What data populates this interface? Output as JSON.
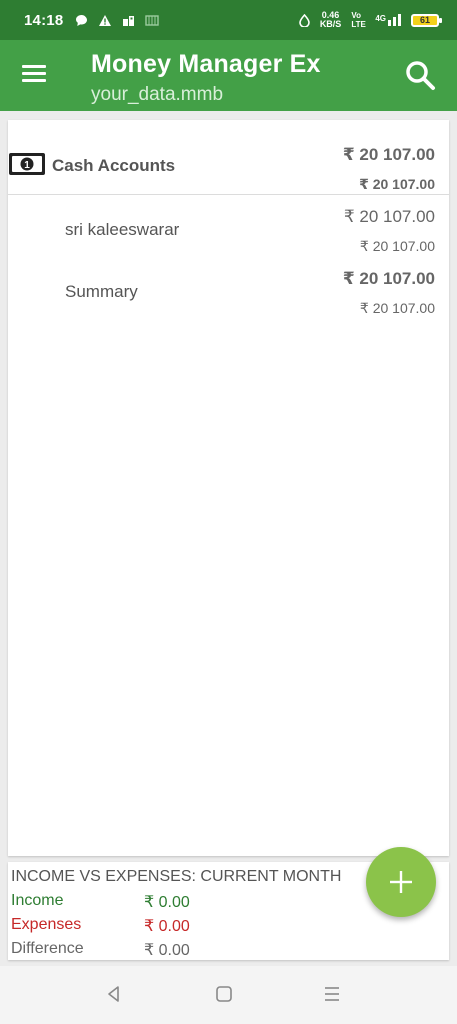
{
  "status_bar": {
    "time": "14:18",
    "net_speed_value": "0.46",
    "net_speed_unit": "KB/S",
    "volte": "Vo LTE",
    "signal": "4G",
    "battery": "61"
  },
  "app_bar": {
    "title": "Money Manager Ex",
    "subtitle": "your_data.mmb",
    "menu_icon": "menu-icon",
    "search_icon": "search-icon"
  },
  "accounts": {
    "group_label": "Cash Accounts",
    "group_icon": "cash-icon",
    "group_balance": "₹ 20 107.00",
    "group_base_balance": "₹ 20 107.00",
    "rows": [
      {
        "label": "sri kaleeswarar",
        "balance": "₹ 20 107.00",
        "base_balance": "₹ 20 107.00"
      },
      {
        "label": "Summary",
        "balance": "₹ 20 107.00",
        "base_balance": "₹ 20 107.00"
      }
    ]
  },
  "income_expenses": {
    "title": "INCOME VS EXPENSES: CURRENT MONTH",
    "income_label": "Income",
    "income_value": "₹ 0.00",
    "expenses_label": "Expenses",
    "expenses_value": "₹ 0.00",
    "difference_label": "Difference",
    "difference_value": "₹ 0.00"
  },
  "fab": {
    "icon": "plus-icon"
  },
  "colors": {
    "status_bar": "#2e7d32",
    "app_bar": "#43a047",
    "fab": "#8bc34a",
    "income": "#2e7d32",
    "expenses": "#c62828"
  }
}
